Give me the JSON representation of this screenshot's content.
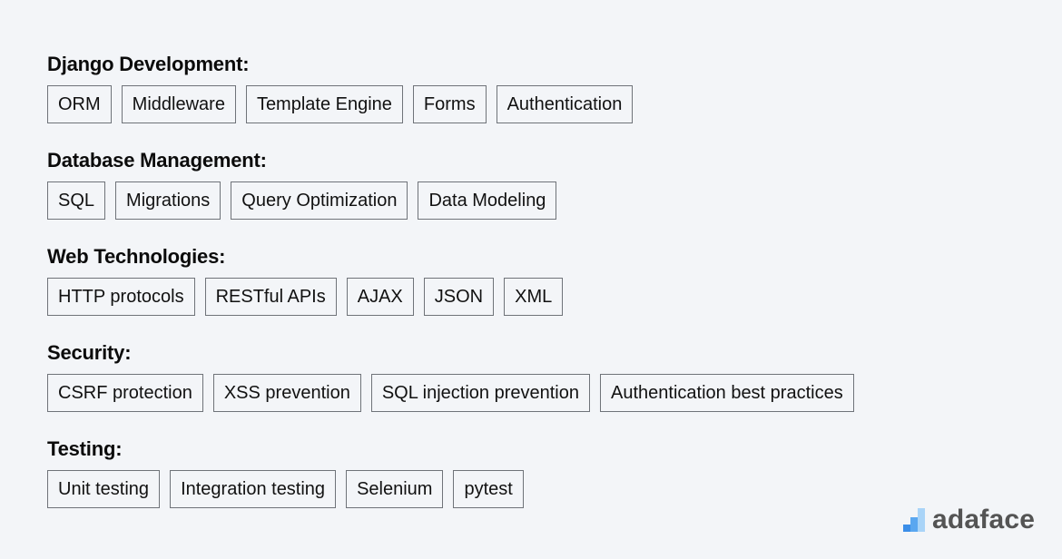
{
  "sections": [
    {
      "title": "Django Development:",
      "skills": [
        "ORM",
        "Middleware",
        "Template Engine",
        "Forms",
        "Authentication"
      ]
    },
    {
      "title": "Database Management:",
      "skills": [
        "SQL",
        "Migrations",
        "Query Optimization",
        "Data Modeling"
      ]
    },
    {
      "title": "Web Technologies:",
      "skills": [
        "HTTP protocols",
        "RESTful APIs",
        "AJAX",
        "JSON",
        "XML"
      ]
    },
    {
      "title": "Security:",
      "skills": [
        "CSRF protection",
        "XSS prevention",
        "SQL injection prevention",
        "Authentication best practices"
      ]
    },
    {
      "title": "Testing:",
      "skills": [
        "Unit testing",
        "Integration testing",
        "Selenium",
        "pytest"
      ]
    }
  ],
  "branding": {
    "logo_text": "adaface",
    "logo_icon": "bar-steps-icon",
    "colors": {
      "bar1": "#3b8ee8",
      "bar2": "#5aa7f0",
      "bar3": "#a9d4f8",
      "text": "#545454"
    }
  }
}
